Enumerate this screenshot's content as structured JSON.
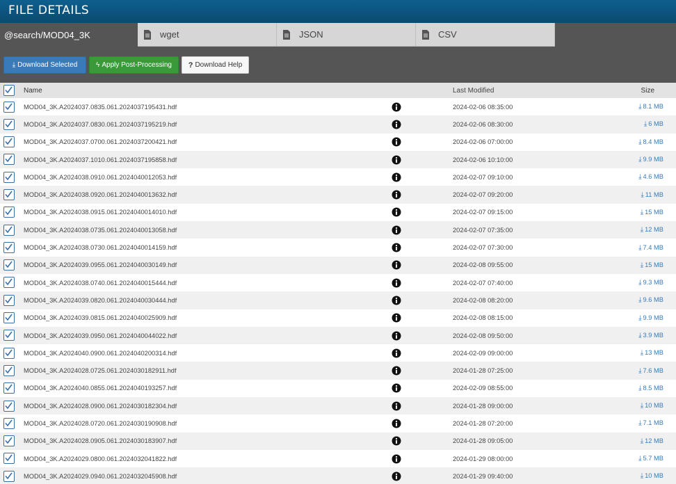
{
  "header": {
    "title": "FILE DETAILS"
  },
  "tabs": [
    {
      "label": "@search/MOD04_3K",
      "active": true,
      "icon": null
    },
    {
      "label": "wget",
      "active": false,
      "icon": "document-icon"
    },
    {
      "label": "JSON",
      "active": false,
      "icon": "document-icon"
    },
    {
      "label": "CSV",
      "active": false,
      "icon": "document-icon"
    }
  ],
  "actions": {
    "download_selected": "Download Selected",
    "apply_post_processing": "Apply Post-Processing",
    "download_help": "Download Help"
  },
  "colors": {
    "header": "#0e5f8e",
    "download": "#3b7ab8",
    "post": "#3a9a3a",
    "toolbar": "#555555"
  },
  "table": {
    "headers": {
      "name": "Name",
      "modified": "Last Modified",
      "size": "Size"
    },
    "rows": [
      {
        "name": "MOD04_3K.A2024037.0835.061.2024037195431.hdf",
        "modified": "2024-02-06 08:35:00",
        "size": "8.1 MB"
      },
      {
        "name": "MOD04_3K.A2024037.0830.061.2024037195219.hdf",
        "modified": "2024-02-06 08:30:00",
        "size": "6 MB"
      },
      {
        "name": "MOD04_3K.A2024037.0700.061.2024037200421.hdf",
        "modified": "2024-02-06 07:00:00",
        "size": "8.4 MB"
      },
      {
        "name": "MOD04_3K.A2024037.1010.061.2024037195858.hdf",
        "modified": "2024-02-06 10:10:00",
        "size": "9.9 MB"
      },
      {
        "name": "MOD04_3K.A2024038.0910.061.2024040012053.hdf",
        "modified": "2024-02-07 09:10:00",
        "size": "4.6 MB"
      },
      {
        "name": "MOD04_3K.A2024038.0920.061.2024040013632.hdf",
        "modified": "2024-02-07 09:20:00",
        "size": "11 MB"
      },
      {
        "name": "MOD04_3K.A2024038.0915.061.2024040014010.hdf",
        "modified": "2024-02-07 09:15:00",
        "size": "15 MB"
      },
      {
        "name": "MOD04_3K.A2024038.0735.061.2024040013058.hdf",
        "modified": "2024-02-07 07:35:00",
        "size": "12 MB"
      },
      {
        "name": "MOD04_3K.A2024038.0730.061.2024040014159.hdf",
        "modified": "2024-02-07 07:30:00",
        "size": "7.4 MB"
      },
      {
        "name": "MOD04_3K.A2024039.0955.061.2024040030149.hdf",
        "modified": "2024-02-08 09:55:00",
        "size": "15 MB"
      },
      {
        "name": "MOD04_3K.A2024038.0740.061.2024040015444.hdf",
        "modified": "2024-02-07 07:40:00",
        "size": "9.3 MB"
      },
      {
        "name": "MOD04_3K.A2024039.0820.061.2024040030444.hdf",
        "modified": "2024-02-08 08:20:00",
        "size": "9.6 MB"
      },
      {
        "name": "MOD04_3K.A2024039.0815.061.2024040025909.hdf",
        "modified": "2024-02-08 08:15:00",
        "size": "9.9 MB"
      },
      {
        "name": "MOD04_3K.A2024039.0950.061.2024040044022.hdf",
        "modified": "2024-02-08 09:50:00",
        "size": "3.9 MB"
      },
      {
        "name": "MOD04_3K.A2024040.0900.061.2024040200314.hdf",
        "modified": "2024-02-09 09:00:00",
        "size": "13 MB"
      },
      {
        "name": "MOD04_3K.A2024028.0725.061.2024030182911.hdf",
        "modified": "2024-01-28 07:25:00",
        "size": "7.6 MB"
      },
      {
        "name": "MOD04_3K.A2024040.0855.061.2024040193257.hdf",
        "modified": "2024-02-09 08:55:00",
        "size": "8.5 MB"
      },
      {
        "name": "MOD04_3K.A2024028.0900.061.2024030182304.hdf",
        "modified": "2024-01-28 09:00:00",
        "size": "10 MB"
      },
      {
        "name": "MOD04_3K.A2024028.0720.061.2024030190908.hdf",
        "modified": "2024-01-28 07:20:00",
        "size": "7.1 MB"
      },
      {
        "name": "MOD04_3K.A2024028.0905.061.2024030183907.hdf",
        "modified": "2024-01-28 09:05:00",
        "size": "12 MB"
      },
      {
        "name": "MOD04_3K.A2024029.0800.061.2024032041822.hdf",
        "modified": "2024-01-29 08:00:00",
        "size": "5.7 MB"
      },
      {
        "name": "MOD04_3K.A2024029.0940.061.2024032045908.hdf",
        "modified": "2024-01-29 09:40:00",
        "size": "10 MB"
      }
    ]
  }
}
